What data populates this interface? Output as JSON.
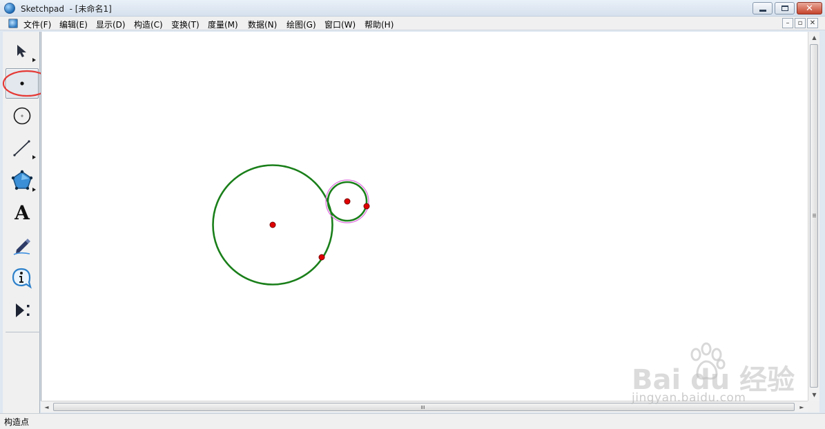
{
  "window": {
    "title": "Sketchpad  - [未命名1]"
  },
  "menu": {
    "items": [
      {
        "label": "文件(F)"
      },
      {
        "label": "编辑(E)"
      },
      {
        "label": "显示(D)"
      },
      {
        "label": "构造(C)"
      },
      {
        "label": "变换(T)"
      },
      {
        "label": "度量(M)"
      },
      {
        "label": "数据(N)"
      },
      {
        "label": "绘图(G)"
      },
      {
        "label": "窗口(W)"
      },
      {
        "label": "帮助(H)"
      }
    ]
  },
  "toolbox": {
    "tools": [
      {
        "name": "arrow-tool",
        "icon": "arrow-select-icon",
        "selected": false
      },
      {
        "name": "point-tool",
        "icon": "point-icon",
        "selected": true
      },
      {
        "name": "compass-tool",
        "icon": "circle-icon",
        "selected": false
      },
      {
        "name": "straightedge-tool",
        "icon": "line-segment-icon",
        "selected": false
      },
      {
        "name": "polygon-tool",
        "icon": "polygon-icon",
        "selected": false
      },
      {
        "name": "text-tool",
        "icon": "text-A-icon",
        "selected": false
      },
      {
        "name": "marker-tool",
        "icon": "marker-pen-icon",
        "selected": false
      },
      {
        "name": "information-tool",
        "icon": "info-icon",
        "selected": false
      },
      {
        "name": "custom-tool",
        "icon": "play-custom-icon",
        "selected": false
      }
    ],
    "text_tool_glyph": "A",
    "info_tool_glyph": "i",
    "highlight_color": "#e53935"
  },
  "sketch": {
    "circle_color": "#1a7f1a",
    "point_color": "#e00000",
    "selection_color": "#e070e0"
  },
  "scrollbar": {
    "up": "▲",
    "down": "▼",
    "left": "◄",
    "right": "►"
  },
  "status": {
    "text": "构造点"
  },
  "watermark": {
    "logo": "Bai  du 经验",
    "url": "jingyan.baidu.com"
  }
}
